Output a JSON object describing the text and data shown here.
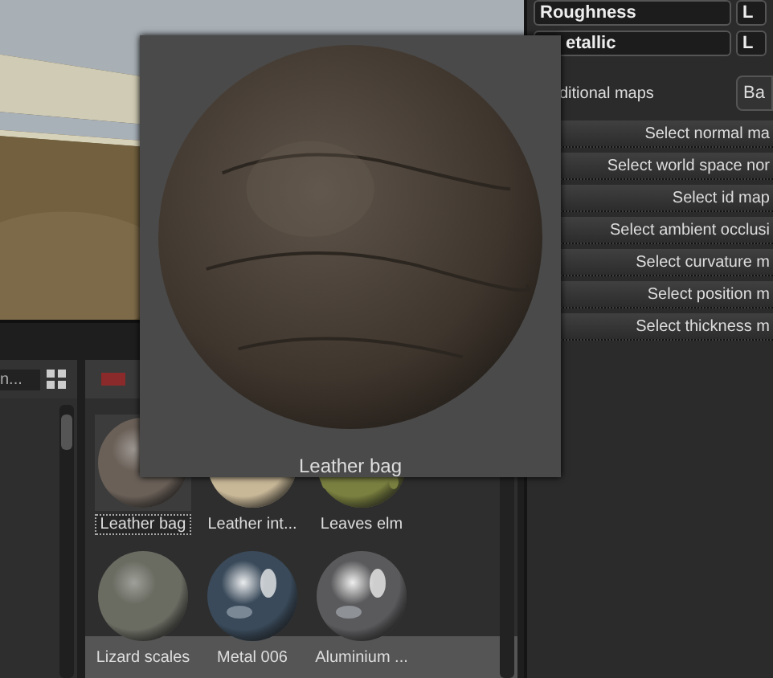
{
  "properties": {
    "fields": [
      {
        "label": "Roughness",
        "value_2": "L"
      },
      {
        "label": "etallic",
        "value_2": "L"
      }
    ]
  },
  "additional_maps": {
    "label": "ditional maps",
    "button": "Ba"
  },
  "map_buttons": [
    "Select normal ma",
    "Select world space nor",
    "Select id map",
    "Select ambient occlusi",
    "Select curvature m",
    "Select position m",
    "Select thickness m"
  ],
  "search": {
    "value": "n..."
  },
  "library": {
    "materials": [
      {
        "name": "Leather bag",
        "selected": true,
        "kind": "matte",
        "color": "#6a6058"
      },
      {
        "name": "Leather int...",
        "selected": false,
        "kind": "matte",
        "color": "#c8b898"
      },
      {
        "name": "Leaves elm",
        "selected": false,
        "kind": "pattern",
        "color": "#7a8040"
      },
      {
        "name": "Lizard scales",
        "selected": false,
        "kind": "matte",
        "color": "#6a6c62"
      },
      {
        "name": "Metal 006",
        "selected": false,
        "kind": "metal",
        "color": "#3a4a5a"
      },
      {
        "name": "Aluminium ...",
        "selected": false,
        "kind": "metal",
        "color": "#5a5a5c"
      }
    ]
  },
  "preview": {
    "title": "Leather bag"
  }
}
